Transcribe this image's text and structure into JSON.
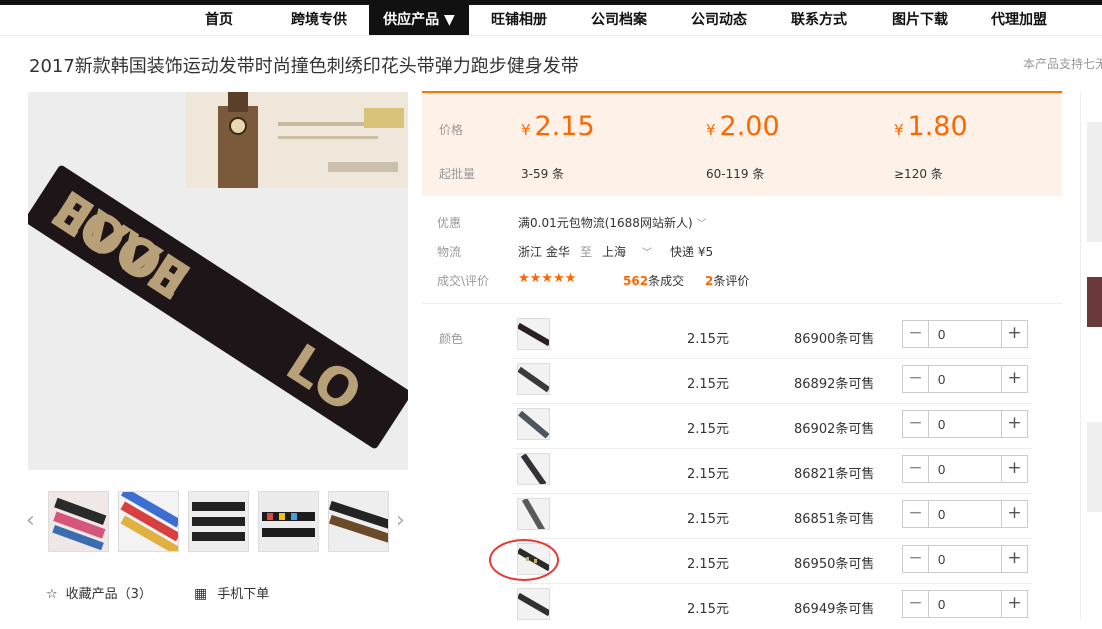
{
  "nav": {
    "items": [
      {
        "label": "首页",
        "active": false
      },
      {
        "label": "跨境专供",
        "active": false
      },
      {
        "label": "供应产品 ▼",
        "active": true
      },
      {
        "label": "旺铺相册",
        "active": false
      },
      {
        "label": "公司档案",
        "active": false
      },
      {
        "label": "公司动态",
        "active": false
      },
      {
        "label": "联系方式",
        "active": false
      },
      {
        "label": "图片下载",
        "active": false
      },
      {
        "label": "代理加盟",
        "active": false
      }
    ]
  },
  "product": {
    "title": "2017新款韩国装饰运动发带时尚撞色刺绣印花头带弹力跑步健身发带",
    "support_note": "本产品支持七无"
  },
  "price_box": {
    "price_label": "价格",
    "moq_label": "起批量",
    "currency": "¥",
    "tiers": [
      {
        "price": "2.15",
        "range": "3-59 条"
      },
      {
        "price": "2.00",
        "range": "60-119 条"
      },
      {
        "price": "1.80",
        "range": "≥120 条"
      }
    ]
  },
  "info": {
    "promo_label": "优惠",
    "promo_value": "满0.01元包物流(1688网站新人)",
    "logistics_label": "物流",
    "origin": "浙江 金华",
    "to_word": "至",
    "destination": "上海",
    "shipping": "快递 ¥5",
    "deal_label": "成交\\评价",
    "rating_stars": 5,
    "stars_text": "★★★★★",
    "deals_count": "562",
    "deals_suffix": "条成交",
    "reviews_count": "2",
    "reviews_suffix": "条评价"
  },
  "sku": {
    "color_label": "颜色",
    "rows": [
      {
        "price": "2.15元",
        "stock": "86900条可售",
        "qty": "0"
      },
      {
        "price": "2.15元",
        "stock": "86892条可售",
        "qty": "0"
      },
      {
        "price": "2.15元",
        "stock": "86902条可售",
        "qty": "0"
      },
      {
        "price": "2.15元",
        "stock": "86821条可售",
        "qty": "0"
      },
      {
        "price": "2.15元",
        "stock": "86851条可售",
        "qty": "0"
      },
      {
        "price": "2.15元",
        "stock": "86950条可售",
        "qty": "0"
      },
      {
        "price": "2.15元",
        "stock": "86949条可售",
        "qty": "0"
      }
    ]
  },
  "actions": {
    "favorite": "收藏产品（3）",
    "mobile_order": "手机下单"
  },
  "colors": {
    "accent": "#ff6600",
    "nav_active_bg": "#111111",
    "price_box_bg": "#fef2e8",
    "highlight_circle": "#e53935"
  }
}
